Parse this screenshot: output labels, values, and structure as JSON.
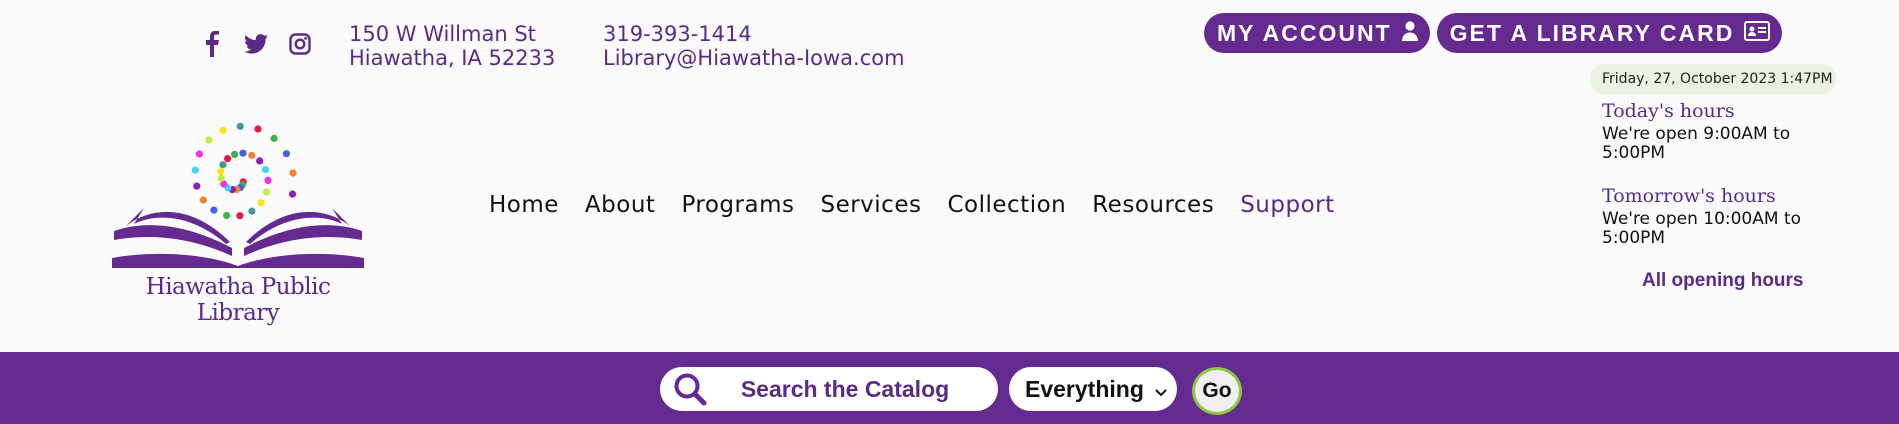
{
  "social": {
    "icons": [
      "facebook-icon",
      "twitter-icon",
      "instagram-icon"
    ]
  },
  "contact": {
    "address_line1": "150 W Willman St",
    "address_line2": "Hiawatha, IA 52233",
    "phone": "319-393-1414",
    "email": "Library@Hiawatha-Iowa.com"
  },
  "top_buttons": {
    "account_label": "MY ACCOUNT",
    "account_icon": "user-icon",
    "card_label": "GET A LIBRARY CARD",
    "card_icon": "id-card-icon"
  },
  "logo": {
    "text": "Hiawatha Public Library"
  },
  "nav": {
    "items": [
      "Home",
      "About",
      "Programs",
      "Services",
      "Collection",
      "Resources",
      "Support"
    ],
    "active": "Support"
  },
  "hours": {
    "date": "Friday, 27, October 2023 1:47PM",
    "today_heading": "Today's hours",
    "today_text": "We're open 9:00AM to 5:00PM",
    "tomorrow_heading": "Tomorrow's hours",
    "tomorrow_text": "We're open 10:00AM to 5:00PM",
    "all_link": "All opening hours"
  },
  "search": {
    "placeholder": "Search the Catalog",
    "icon": "search-icon",
    "scope_selected": "Everything",
    "go_label": "Go"
  },
  "colors": {
    "brand_purple": "#652a8f",
    "accent_green": "#8cc63f"
  }
}
